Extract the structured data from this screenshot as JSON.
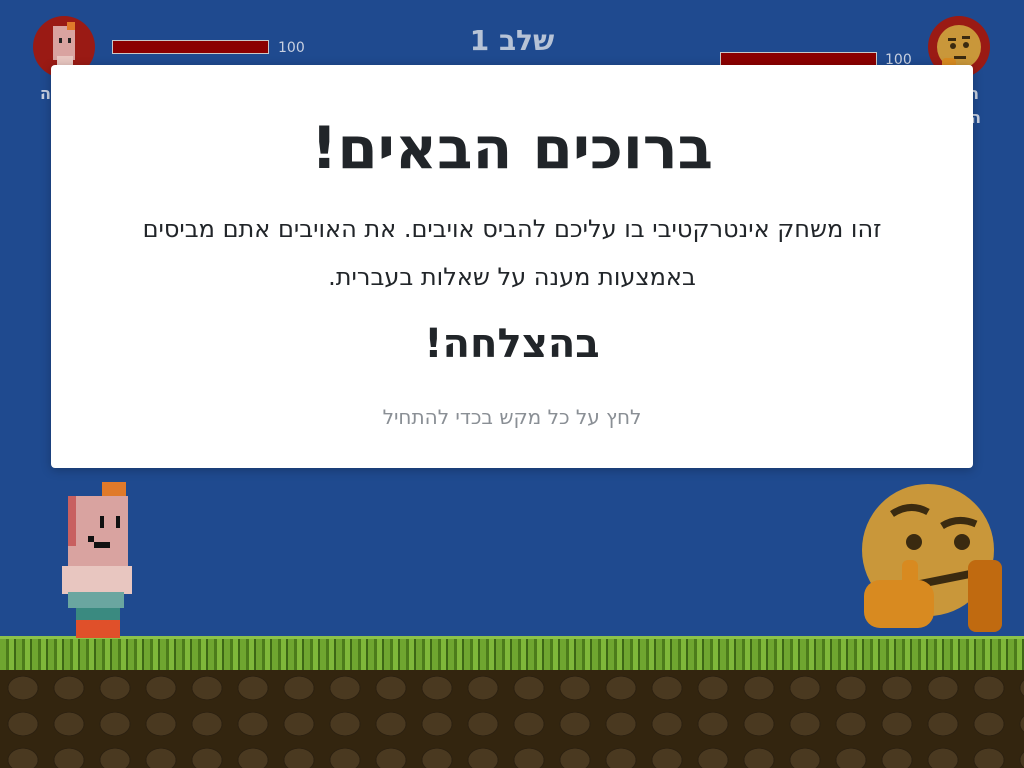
{
  "hud": {
    "level_label": "שלב 1",
    "player": {
      "hp": "100",
      "hp_fraction": 1.0,
      "name_fragment": "ה"
    },
    "enemy": {
      "hp": "100",
      "hp_fraction": 1.0,
      "name_fragment_1": "ה",
      "name_fragment_2": "ה"
    }
  },
  "modal": {
    "title": "ברוכים הבאים!",
    "description": "זהו משחק אינטרקטיבי בו עליכם להביס אויבים. את האויבים אתם מביסים באמצעות מענה על שאלות בעברית.",
    "good_luck": "בהצלחה!",
    "hint": "לחץ על כל מקש בכדי להתחיל"
  },
  "colors": {
    "background": "#1f4a8f",
    "hp_bar": "#8b0000",
    "modal": "#ffffff"
  },
  "icons": {
    "player_avatar": "pixel-hero-icon",
    "enemy_avatar": "thinking-face-icon"
  }
}
